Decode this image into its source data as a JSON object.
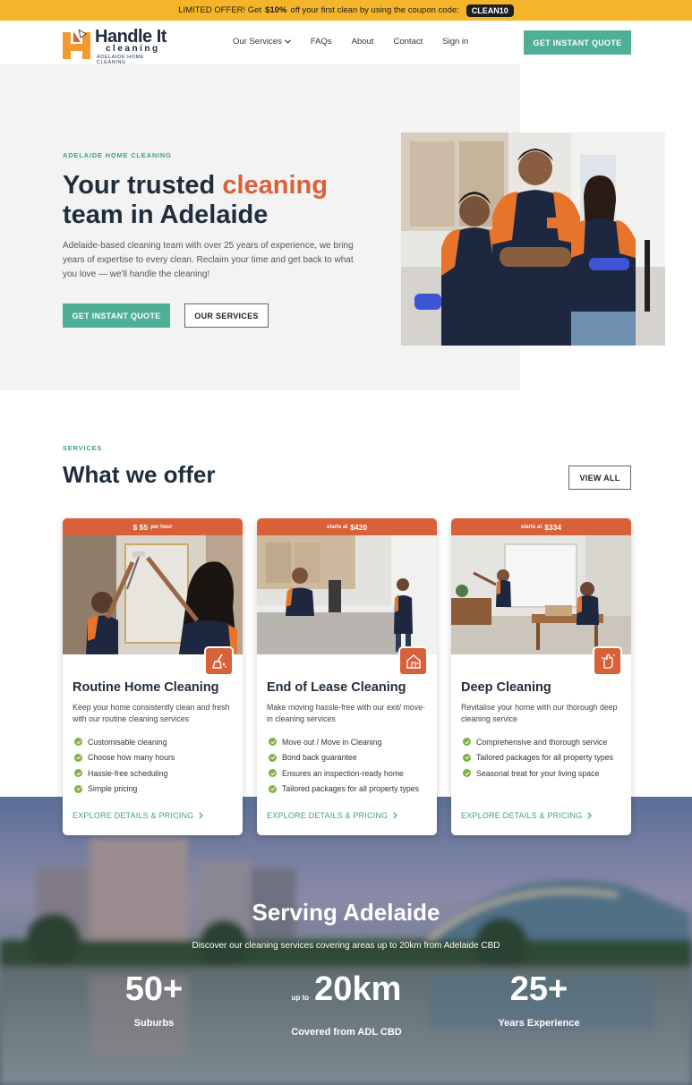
{
  "promo": {
    "prefix": "LIMITED OFFER! Get",
    "highlight": "$10%",
    "suffix": "off your first clean by using the coupon code:",
    "code": "CLEAN10"
  },
  "logo": {
    "word": "Handle It",
    "sub1": "cleaning",
    "sub2": "ADELAIDE HOME CLEANING"
  },
  "nav": {
    "links": [
      "Our Services",
      "FAQs",
      "About",
      "Contact",
      "Sign in"
    ],
    "cta": "GET INSTANT QUOTE"
  },
  "hero": {
    "eyebrow": "ADELAIDE HOME CLEANING",
    "title_pre": "Your trusted ",
    "title_accent": "cleaning",
    "title_post": " team in Adelaide",
    "text": "Adelaide-based cleaning team with over 25 years of experience, we bring years of expertise to every clean. Reclaim your time and get back to what you love — we'll handle the cleaning!",
    "cta_primary": "GET INSTANT QUOTE",
    "cta_secondary": "OUR SERVICES"
  },
  "services": {
    "eyebrow": "SERVICES",
    "title": "What we offer",
    "view_all": "VIEW ALL",
    "cards": [
      {
        "price_pre": "",
        "price": "$ 55",
        "price_post": "per hour",
        "title": "Routine Home Cleaning",
        "desc": "Keep your home consistently clean and fresh with our routine cleaning services",
        "features": [
          "Customisable cleaning",
          "Choose how many hours",
          "Hassle-free scheduling",
          "Simple pricing"
        ],
        "link": "EXPLORE DETAILS & PRICING"
      },
      {
        "price_pre": "starts at",
        "price": "$420",
        "price_post": "",
        "title": "End of Lease Cleaning",
        "desc": "Make moving hassle-free with our exit/ move-in cleaning services",
        "features": [
          "Move out / Move in Cleaning",
          "Bond back guarantee",
          "Ensures an inspection-ready home",
          "Tailored packages for all property types"
        ],
        "link": "EXPLORE DETAILS & PRICING"
      },
      {
        "price_pre": "starts at",
        "price": "$334",
        "price_post": "",
        "title": "Deep Cleaning",
        "desc": "Revitalise your home with our thorough deep cleaning service",
        "features": [
          "Comprehensive and thorough service",
          "Tailored packages for all property types",
          "Seasonal treat for your living space"
        ],
        "link": "EXPLORE DETAILS & PRICING"
      }
    ]
  },
  "serving": {
    "title": "Serving Adelaide",
    "subtitle": "Discover our cleaning services covering areas up to 20km from Adelaide CBD",
    "stats": [
      {
        "prefix": "",
        "value": "50+",
        "label": "Suburbs"
      },
      {
        "prefix": "up to",
        "value": "20km",
        "label": "Covered from ADL CBD"
      },
      {
        "prefix": "",
        "value": "25+",
        "label": "Years Experience"
      }
    ]
  },
  "colors": {
    "promo": "#f5b52a",
    "teal": "#4fae96",
    "orange": "#d8613a",
    "navy": "#1f2d3d"
  }
}
